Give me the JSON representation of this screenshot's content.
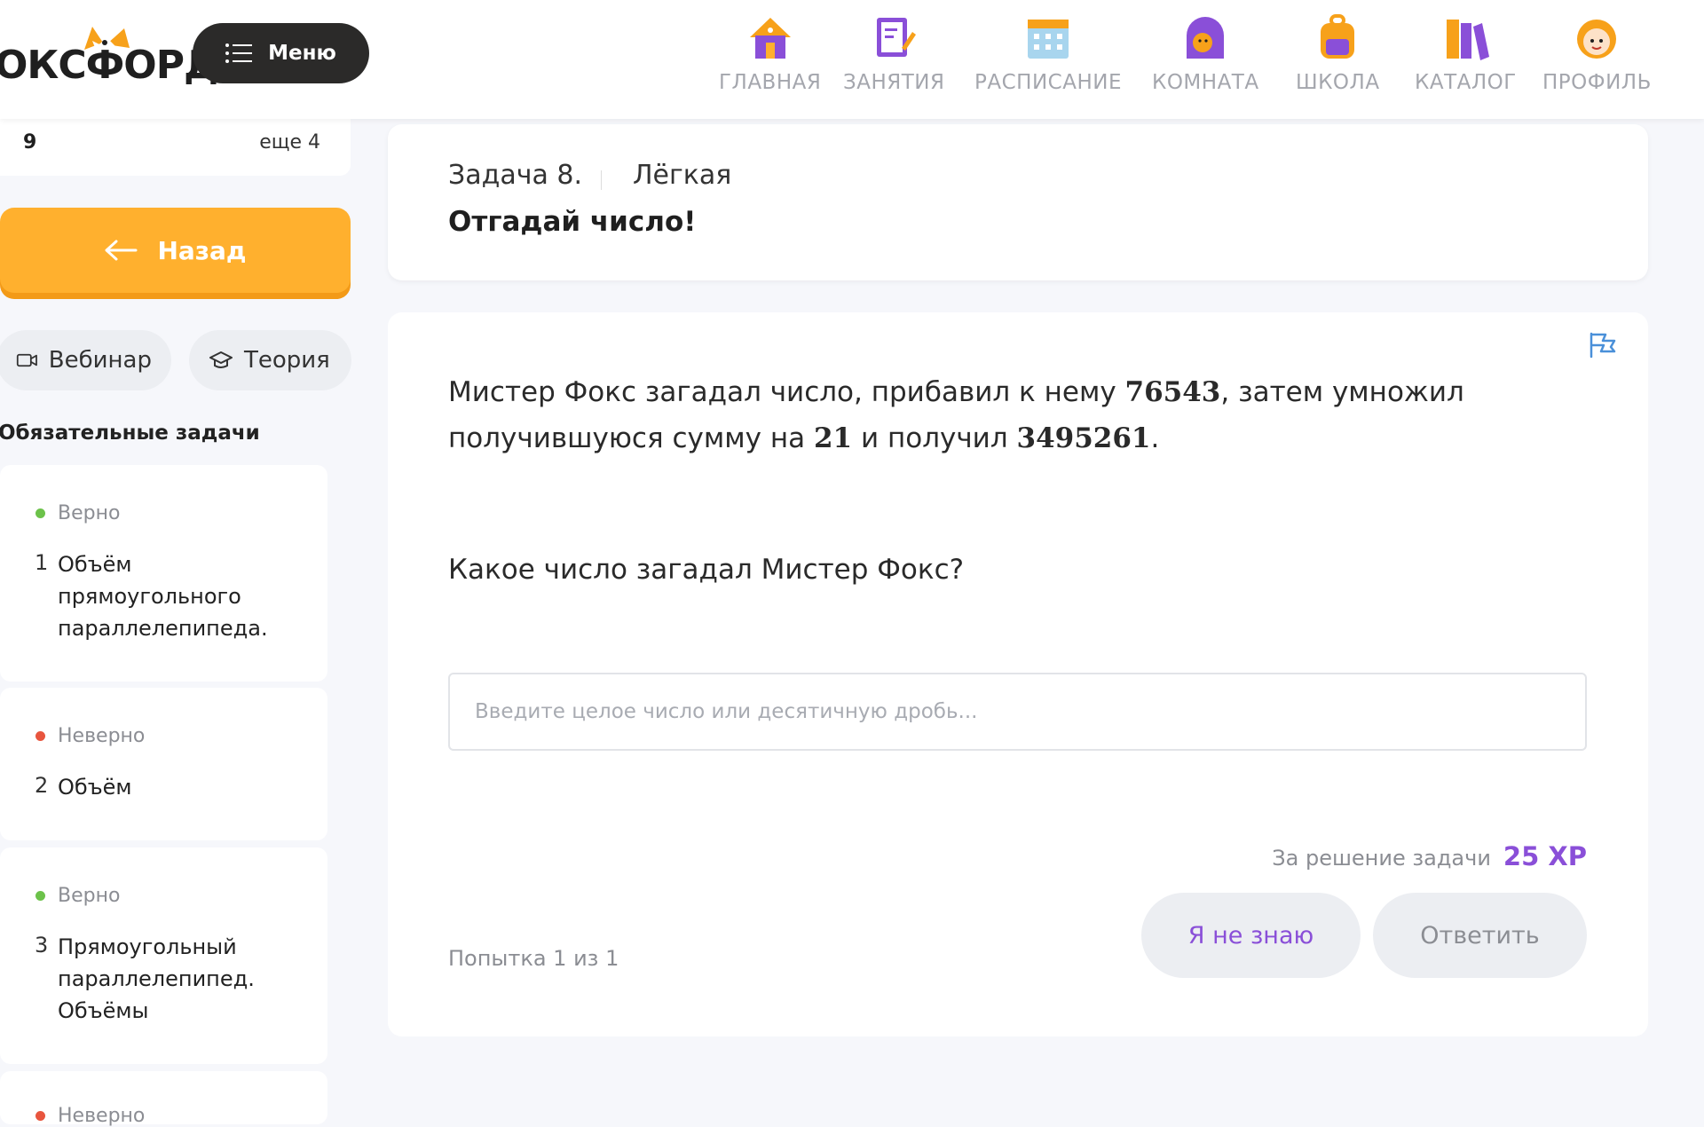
{
  "header": {
    "logo_text": "ОКСФОРД",
    "menu_label": "Меню",
    "nav": [
      {
        "label": "ГЛАВНАЯ",
        "icon": "house-icon"
      },
      {
        "label": "ЗАНЯТИЯ",
        "icon": "notebook-icon"
      },
      {
        "label": "РАСПИСАНИЕ",
        "icon": "calendar-icon"
      },
      {
        "label": "КОМНАТА",
        "icon": "room-door-icon"
      },
      {
        "label": "ШКОЛА",
        "icon": "backpack-icon"
      },
      {
        "label": "КАТАЛОГ",
        "icon": "books-icon"
      },
      {
        "label": "ПРОФИЛЬ",
        "icon": "avatar-icon"
      }
    ]
  },
  "sidebar": {
    "stat_left": "9",
    "stat_right": "еще 4",
    "back_label": "Назад",
    "webinar_label": "Вебинар",
    "theory_label": "Теория",
    "section_title": "Обязательные задачи",
    "tasks": [
      {
        "status": "Верно",
        "number": "1",
        "title": "Объём прямоугольного параллелепипеда."
      },
      {
        "status": "Неверно",
        "number": "2",
        "title": "Объём"
      },
      {
        "status": "Верно",
        "number": "3",
        "title": "Прямоугольный параллелепипед. Объёмы"
      },
      {
        "status": "Неверно"
      }
    ]
  },
  "task": {
    "label": "Задача 8.",
    "difficulty": "Лёгкая",
    "name": "Отгадай число!",
    "text_part1": "Мистер Фокс загадал число, прибавил к нему ",
    "num1": "76543",
    "text_part2": ", затем умножил получившуюся сумму на ",
    "num2": "21",
    "text_part3": " и получил ",
    "num3": "3495261",
    "text_part4": ".",
    "question": "Какое число загадал Мистер Фокс?",
    "input_placeholder": "Введите целое число или десятичную дробь...",
    "reward_label": "За решение задачи",
    "reward_xp": "25 XP",
    "attempts": "Попытка 1 из 1",
    "dont_know_label": "Я не знаю",
    "answer_label": "Ответить"
  },
  "colors": {
    "accent_orange": "#ffb02e",
    "accent_purple": "#8a4fd8",
    "status_correct": "#6cc24a",
    "status_wrong": "#e8553e",
    "flag_blue": "#4a90d9"
  }
}
